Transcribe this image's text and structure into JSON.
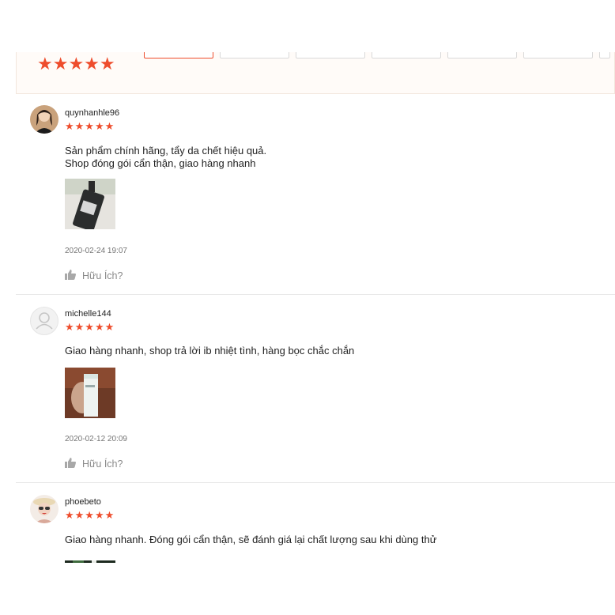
{
  "summary": {
    "stars": "★★★★★",
    "accent": "#ee4d2d"
  },
  "reviews": [
    {
      "username": "quynhanhle96",
      "stars": "★★★★★",
      "comment_lines": [
        "Sản phẩm chính hãng, tẩy da chết hiệu quả.",
        "Shop đóng gói cẩn thận, giao hàng nhanh"
      ],
      "date": "2020-02-24 19:07",
      "helpful": "Hữu Ích?"
    },
    {
      "username": "michelle144",
      "stars": "★★★★★",
      "comment_lines": [
        "Giao hàng nhanh, shop trả lời ib nhiệt tình, hàng bọc chắc chắn"
      ],
      "date": "2020-02-12 20:09",
      "helpful": "Hữu Ích?"
    },
    {
      "username": "phoebeto",
      "stars": "★★★★★",
      "comment_lines": [
        "Giao hàng nhanh. Đóng gói cẩn thận, sẽ đánh giá lại chất lượng sau khi dùng thử"
      ]
    }
  ]
}
